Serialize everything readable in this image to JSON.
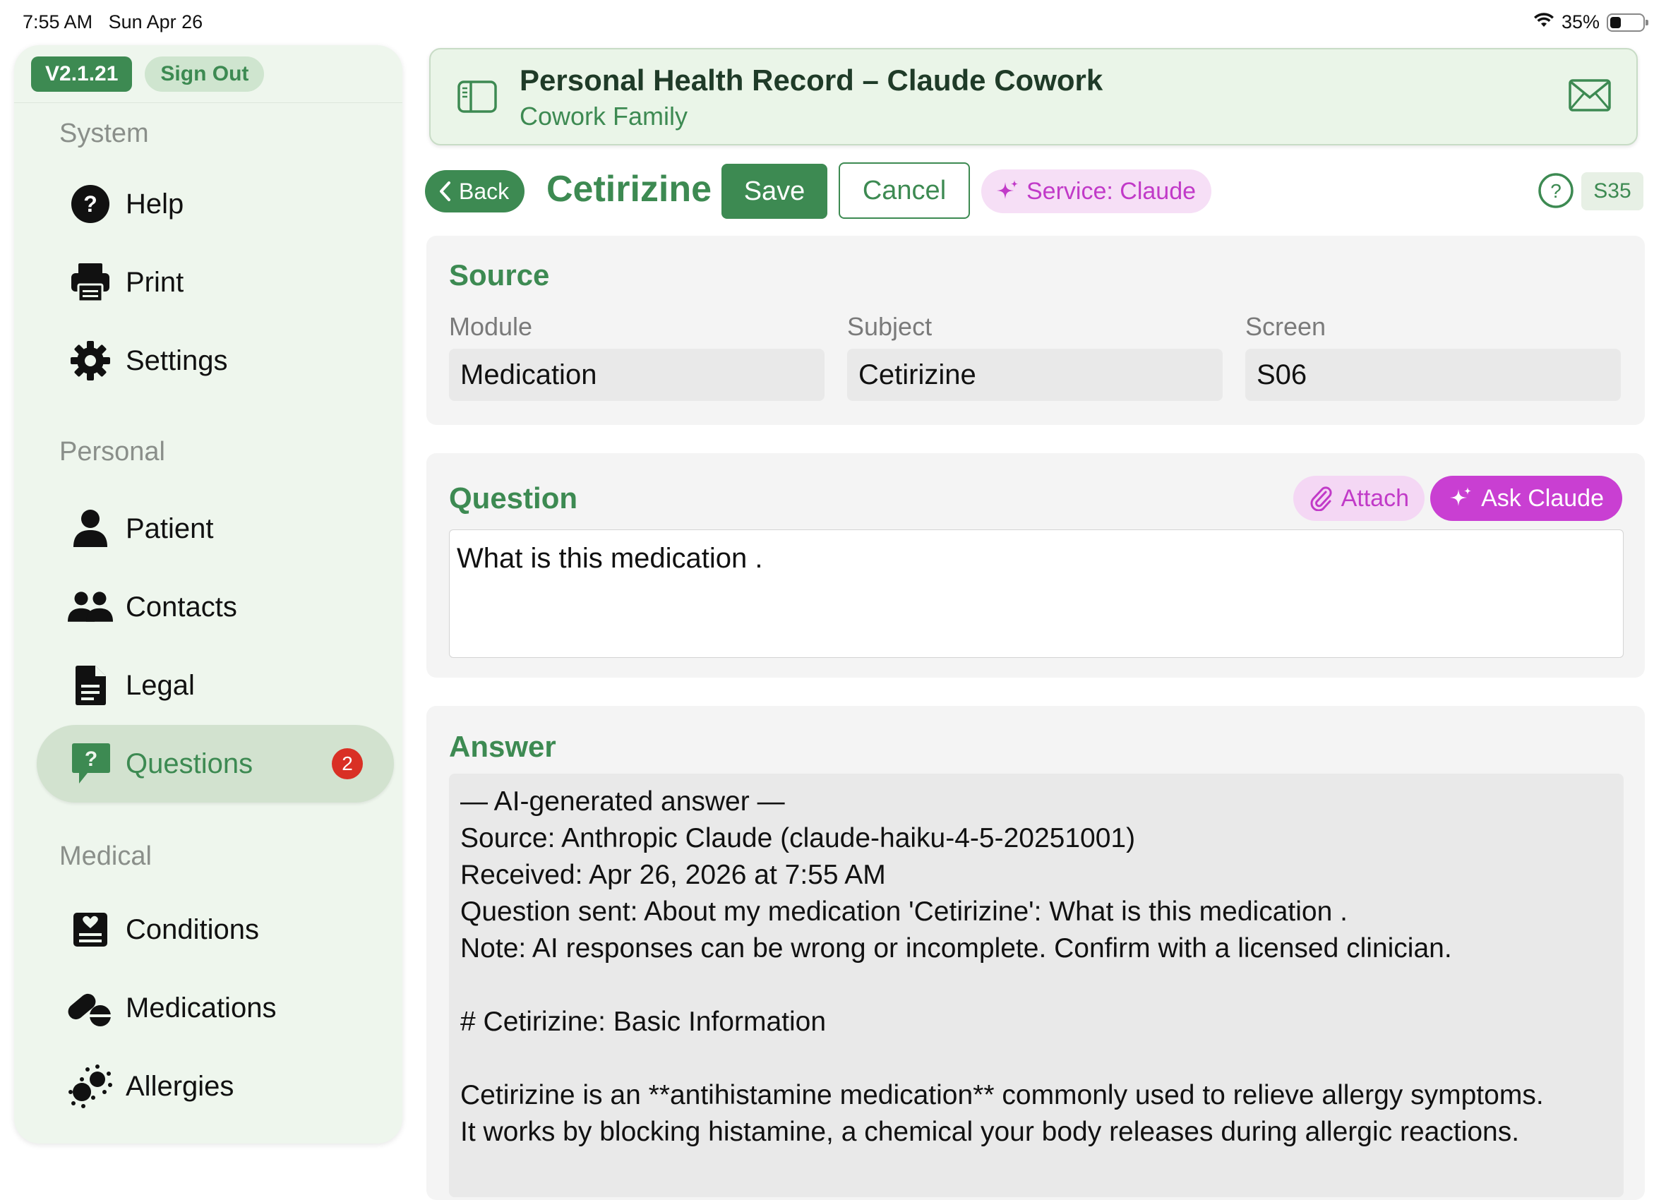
{
  "status_bar": {
    "time": "7:55 AM",
    "date": "Sun Apr 26",
    "battery": "35%",
    "battery_level": 0.35,
    "icons": [
      "wifi-icon",
      "battery-icon"
    ]
  },
  "sidebar": {
    "version": "V2.1.21",
    "sign_out": "Sign Out",
    "sections": {
      "system": "System",
      "personal": "Personal",
      "medical": "Medical"
    },
    "items": {
      "help": "Help",
      "print": "Print",
      "settings": "Settings",
      "patient": "Patient",
      "contacts": "Contacts",
      "legal": "Legal",
      "questions": "Questions",
      "questions_badge": "2",
      "conditions": "Conditions",
      "medications": "Medications",
      "allergies": "Allergies"
    }
  },
  "header": {
    "title": "Personal Health Record – Claude Cowork",
    "subtitle": "Cowork Family"
  },
  "toolbar": {
    "back": "Back",
    "heading": "Cetirizine",
    "save": "Save",
    "cancel": "Cancel",
    "service": "Service: Claude",
    "screen_code": "S35"
  },
  "source": {
    "title": "Source",
    "module_label": "Module",
    "module_value": "Medication",
    "subject_label": "Subject",
    "subject_value": "Cetirizine",
    "screen_label": "Screen",
    "screen_value": "S06"
  },
  "question": {
    "title": "Question",
    "attach": "Attach",
    "ask": "Ask Claude",
    "text": "What is this medication ."
  },
  "answer": {
    "title": "Answer",
    "lines": [
      "— AI-generated answer —",
      "Source: Anthropic Claude (claude-haiku-4-5-20251001)",
      "Received: Apr 26, 2026 at 7:55 AM",
      "Question sent: About my medication 'Cetirizine': What is this medication .",
      "Note: AI responses can be wrong or incomplete. Confirm with a licensed clinician.",
      "",
      "# Cetirizine: Basic Information",
      "",
      "Cetirizine is an **antihistamine medication** commonly used to relieve allergy symptoms.",
      "It works by blocking histamine, a chemical your body releases during allergic reactions."
    ]
  },
  "colors": {
    "brand_green": "#3d8a52",
    "sidebar_bg": "#eef6ed",
    "accent_purple": "#c93fd2",
    "badge_red": "#d93025"
  }
}
